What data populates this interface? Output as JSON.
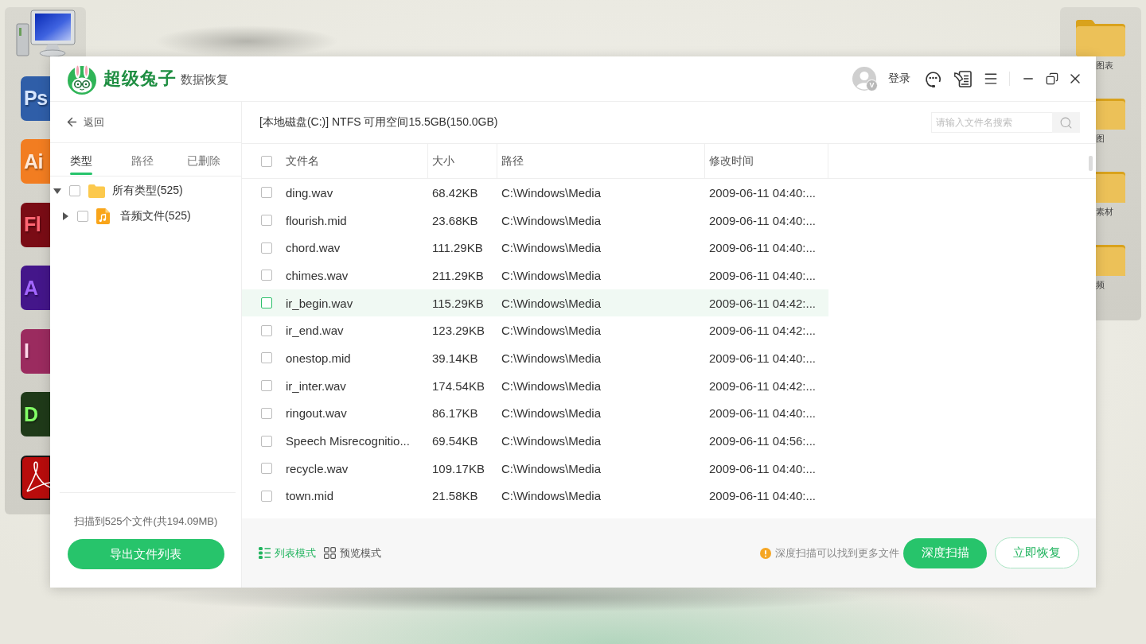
{
  "desktop": {
    "left_dock": [
      {
        "kind": "computer"
      },
      {
        "kind": "letter_tile",
        "letters": "Ps",
        "color": "#2f5ea8"
      },
      {
        "kind": "letter_tile",
        "letters": "Ai",
        "color": "#f27d21"
      },
      {
        "kind": "letter_tile",
        "letters": "Fl",
        "color": "#7a0c15"
      },
      {
        "kind": "letter_tile",
        "letters": "A",
        "color": "#44168a"
      },
      {
        "kind": "letter_tile",
        "letters": "I",
        "color": "#9b2b5f"
      },
      {
        "kind": "letter_tile",
        "letters": "D",
        "color": "#1f3a19"
      },
      {
        "kind": "swirl_tile",
        "color": "#b80c0c"
      }
    ],
    "right_dock": [
      {
        "label": "图表"
      },
      {
        "label": "图"
      },
      {
        "label": "素材"
      },
      {
        "label": "频"
      }
    ]
  },
  "window": {
    "logo_title": "超级兔子",
    "logo_subtitle": "数据恢复",
    "avatar_badge": "V",
    "login": "登录",
    "back": "返回",
    "sidebar_tabs": [
      {
        "label": "类型",
        "selected": true
      },
      {
        "label": "路径",
        "selected": false
      },
      {
        "label": "已删除",
        "selected": false
      }
    ],
    "tree": [
      {
        "label": "所有类型(525)",
        "kind": "folder",
        "expanded": true,
        "checked": false,
        "children": [
          {
            "label": "音频文件(525)",
            "kind": "audio",
            "expanded": false,
            "checked": false
          }
        ]
      }
    ],
    "scan_summary": "扫描到525个文件(共194.09MB)",
    "export_button": "导出文件列表",
    "disk_info": "[本地磁盘(C:)] NTFS 可用空间15.5GB(150.0GB)",
    "search": {
      "placeholder": "请输入文件名搜索"
    },
    "table": {
      "select_all_checked": false,
      "columns": [
        "文件名",
        "大小",
        "路径",
        "修改时间"
      ],
      "rows": [
        {
          "name": "ding.wav",
          "size": "68.42KB",
          "path": "C:\\Windows\\Media",
          "modified": "2009-06-11 04:40:...",
          "checked": false,
          "highlighted": false
        },
        {
          "name": "flourish.mid",
          "size": "23.68KB",
          "path": "C:\\Windows\\Media",
          "modified": "2009-06-11 04:40:...",
          "checked": false,
          "highlighted": false
        },
        {
          "name": "chord.wav",
          "size": "111.29KB",
          "path": "C:\\Windows\\Media",
          "modified": "2009-06-11 04:40:...",
          "checked": false,
          "highlighted": false
        },
        {
          "name": "chimes.wav",
          "size": "211.29KB",
          "path": "C:\\Windows\\Media",
          "modified": "2009-06-11 04:40:...",
          "checked": false,
          "highlighted": false
        },
        {
          "name": "ir_begin.wav",
          "size": "115.29KB",
          "path": "C:\\Windows\\Media",
          "modified": "2009-06-11 04:42:...",
          "checked": false,
          "highlighted": true
        },
        {
          "name": "ir_end.wav",
          "size": "123.29KB",
          "path": "C:\\Windows\\Media",
          "modified": "2009-06-11 04:42:...",
          "checked": false,
          "highlighted": false
        },
        {
          "name": "onestop.mid",
          "size": "39.14KB",
          "path": "C:\\Windows\\Media",
          "modified": "2009-06-11 04:40:...",
          "checked": false,
          "highlighted": false
        },
        {
          "name": "ir_inter.wav",
          "size": "174.54KB",
          "path": "C:\\Windows\\Media",
          "modified": "2009-06-11 04:42:...",
          "checked": false,
          "highlighted": false
        },
        {
          "name": "ringout.wav",
          "size": "86.17KB",
          "path": "C:\\Windows\\Media",
          "modified": "2009-06-11 04:40:...",
          "checked": false,
          "highlighted": false
        },
        {
          "name": "Speech Misrecognitio...",
          "size": "69.54KB",
          "path": "C:\\Windows\\Media",
          "modified": "2009-06-11 04:56:...",
          "checked": false,
          "highlighted": false
        },
        {
          "name": "recycle.wav",
          "size": "109.17KB",
          "path": "C:\\Windows\\Media",
          "modified": "2009-06-11 04:40:...",
          "checked": false,
          "highlighted": false
        },
        {
          "name": "town.mid",
          "size": "21.58KB",
          "path": "C:\\Windows\\Media",
          "modified": "2009-06-11 04:40:...",
          "checked": false,
          "highlighted": false
        }
      ]
    },
    "view_modes": [
      {
        "label": "列表模式",
        "kind": "list",
        "selected": true
      },
      {
        "label": "预览模式",
        "kind": "grid",
        "selected": false
      }
    ],
    "hint": "深度扫描可以找到更多文件",
    "actions": [
      {
        "label": "深度扫描",
        "kind": "primary"
      },
      {
        "label": "立即恢复",
        "kind": "outline"
      }
    ]
  }
}
